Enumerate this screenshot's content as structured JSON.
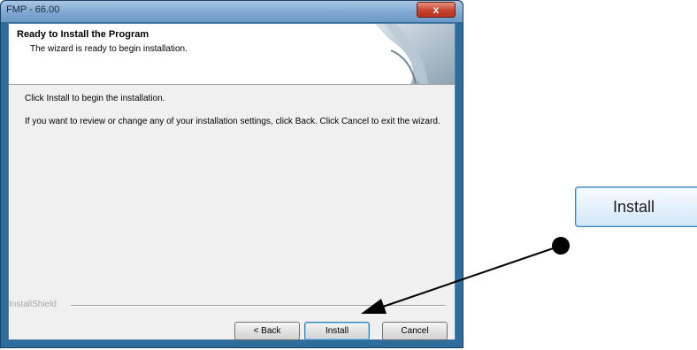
{
  "window": {
    "title": "FMP - 66.00",
    "close_symbol": "x"
  },
  "header": {
    "title": "Ready to Install the Program",
    "subtitle": "The wizard is ready to begin installation."
  },
  "body": {
    "line1": "Click Install to begin the installation.",
    "line2": "If you want to review or change any of your installation settings, click Back. Click Cancel to exit the wizard."
  },
  "footer": {
    "brand": "InstallShield"
  },
  "buttons": {
    "back": "< Back",
    "install": "Install",
    "cancel": "Cancel"
  },
  "callout": {
    "label": "Install"
  },
  "icons": {
    "banner": "installer-banner-icon",
    "pointer": "pointer-arrow-icon",
    "marker": "marker-dot-icon"
  },
  "colors": {
    "window_frame": "#2d6d9c",
    "titlebar": "#7fa8d1",
    "close_button": "#c8442f",
    "default_button_border": "#3c7fb1"
  }
}
